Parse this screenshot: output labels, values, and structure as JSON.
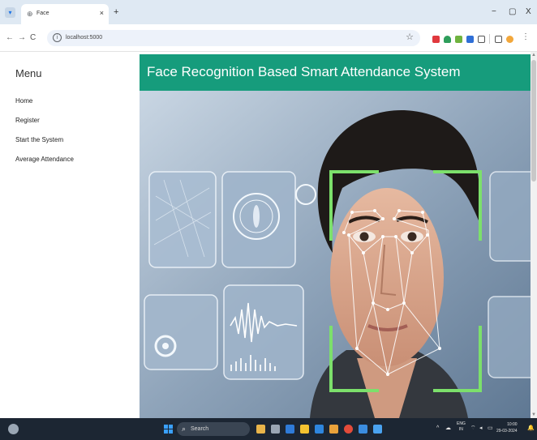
{
  "browser": {
    "tab_title": "Face",
    "tab_icon": "globe-icon",
    "tab_close": "×",
    "new_tab": "+",
    "window_controls": [
      "−",
      "▢",
      "X"
    ],
    "url": "localhost:5000",
    "nav_icons": [
      "back-icon",
      "forward-icon",
      "reload-icon"
    ],
    "nav_glyphs": [
      "←",
      "→",
      "C"
    ]
  },
  "sidebar": {
    "heading": "Menu",
    "items": [
      {
        "label": "Home"
      },
      {
        "label": "Register"
      },
      {
        "label": "Start the System"
      },
      {
        "label": "Average Attendance"
      }
    ]
  },
  "header": {
    "title": "Face Recognition Based Smart Attendance System",
    "color": "#169c7c"
  },
  "taskbar": {
    "search_label": "Search",
    "language": "ENG",
    "region": "IN",
    "time": "10:00",
    "date": "29-03-2024"
  }
}
